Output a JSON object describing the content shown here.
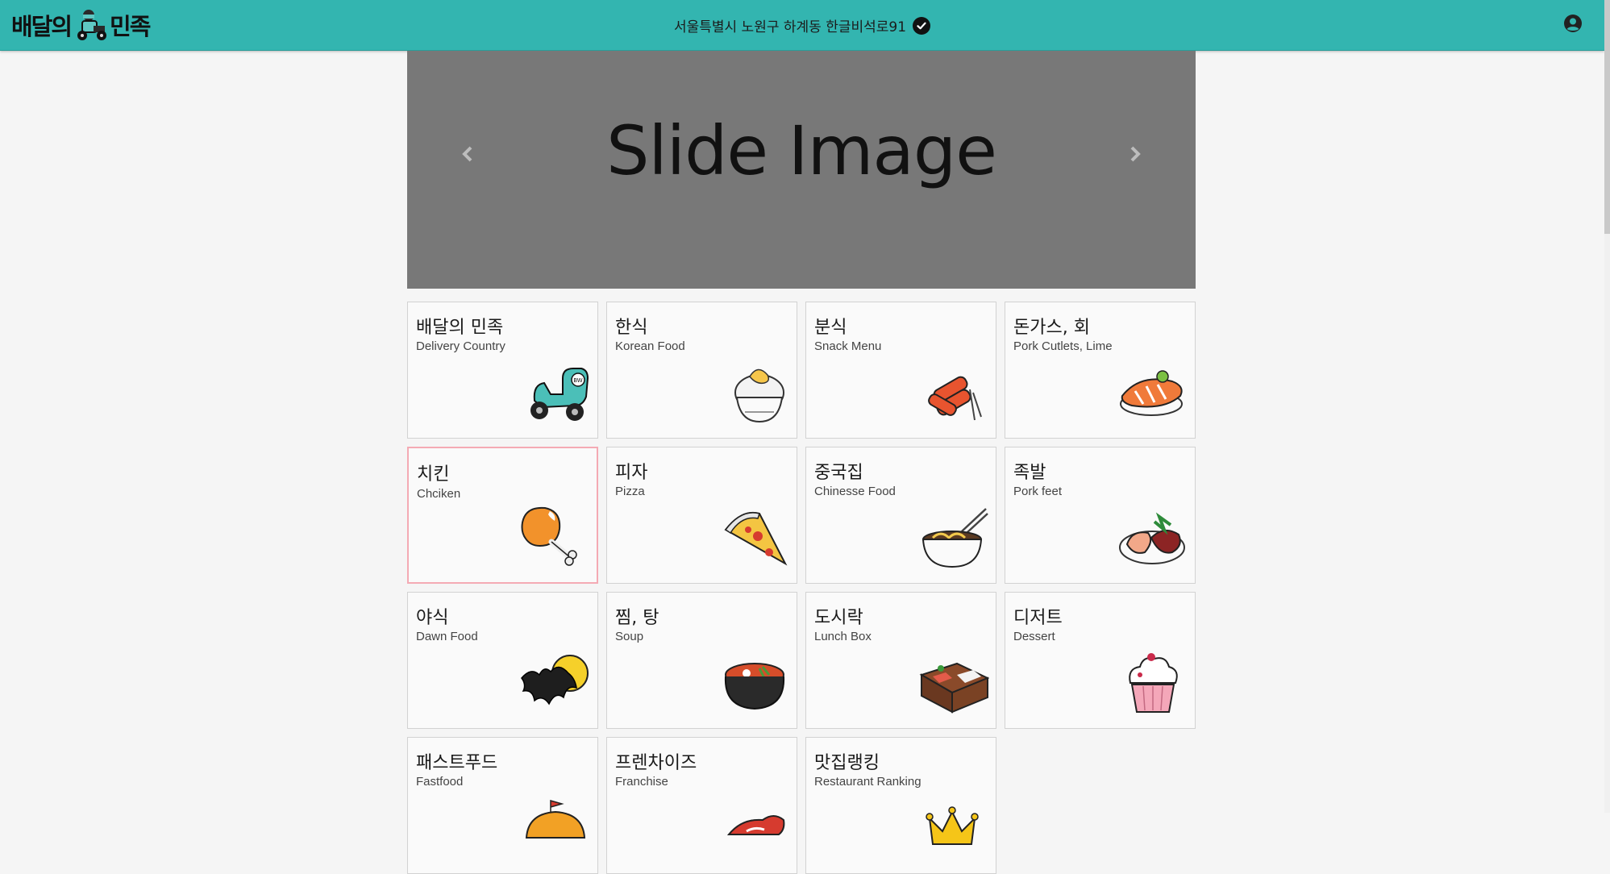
{
  "header": {
    "logo_part1": "배달의",
    "logo_part2": "민족",
    "logo_small": "의",
    "address": "서울특별시 노원구 하계동 한글비석로91"
  },
  "slider": {
    "text": "Slide Image"
  },
  "categories": [
    {
      "title": "배달의 민족",
      "sub": "Delivery Country",
      "icon": "scooter-icon"
    },
    {
      "title": "한식",
      "sub": "Korean Food",
      "icon": "rice-bowl-icon"
    },
    {
      "title": "분식",
      "sub": "Snack Menu",
      "icon": "tteokbokki-icon"
    },
    {
      "title": "돈가스, 회",
      "sub": "Pork Cutlets, Lime",
      "icon": "sushi-icon"
    },
    {
      "title": "치킨",
      "sub": "Chciken",
      "icon": "chicken-leg-icon"
    },
    {
      "title": "피자",
      "sub": "Pizza",
      "icon": "pizza-slice-icon"
    },
    {
      "title": "중국집",
      "sub": "Chinesse Food",
      "icon": "noodle-bowl-icon"
    },
    {
      "title": "족발",
      "sub": "Pork feet",
      "icon": "pork-feet-icon"
    },
    {
      "title": "야식",
      "sub": "Dawn Food",
      "icon": "bat-moon-icon"
    },
    {
      "title": "찜, 탕",
      "sub": "Soup",
      "icon": "stew-pot-icon"
    },
    {
      "title": "도시락",
      "sub": "Lunch Box",
      "icon": "lunch-box-icon"
    },
    {
      "title": "디저트",
      "sub": "Dessert",
      "icon": "cupcake-icon"
    },
    {
      "title": "패스트푸드",
      "sub": "Fastfood",
      "icon": "burger-icon"
    },
    {
      "title": "프렌차이즈",
      "sub": "Franchise",
      "icon": "franchise-hat-icon"
    },
    {
      "title": "맛집랭킹",
      "sub": "Restaurant Ranking",
      "icon": "crown-icon"
    }
  ],
  "colors": {
    "header_bg": "#33b5b0",
    "active_border": "#f4aab4",
    "slider_bg": "#787878"
  }
}
